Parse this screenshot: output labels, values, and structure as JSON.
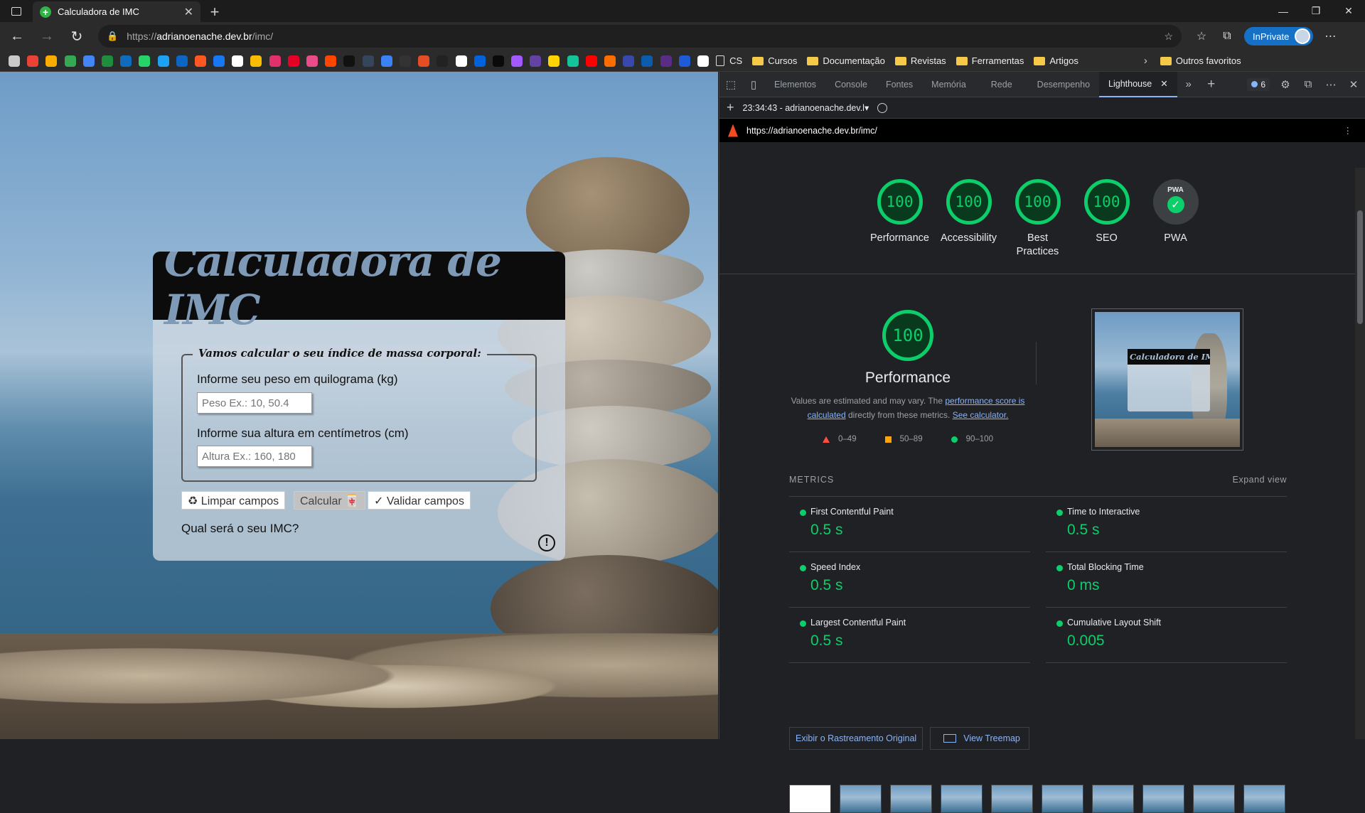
{
  "browser": {
    "tab_title": "Calculadora de IMC",
    "url_scheme": "https://",
    "url_host": "adrianoenache.dev.br",
    "url_path": "/imc/",
    "inprivate_label": "InPrivate"
  },
  "favorites": {
    "folders": [
      "CS",
      "Cursos",
      "Documentação",
      "Revistas",
      "Ferramentas",
      "Artigos"
    ],
    "other": "Outros favoritos",
    "icon_colors": [
      "#c9c9c9",
      "#ea4335",
      "#f9ab00",
      "#34a853",
      "#4285f4",
      "#1e8e3e",
      "#0f6cbd",
      "#25d366",
      "#1da1f2",
      "#0a66c2",
      "#ff5722",
      "#1877f2",
      "#ffffff",
      "#fbbc04",
      "#e1306c",
      "#e60023",
      "#ea4c89",
      "#ff4500",
      "#111111",
      "#35465c",
      "#3b82f6",
      "#333333",
      "#e44d26",
      "#222222",
      "#ffffff",
      "#0063dc",
      "#0a0a0a",
      "#a259ff",
      "#6441a5",
      "#ffd400",
      "#15c39a",
      "#ff0000",
      "#ff6d00",
      "#3949ab",
      "#0b5cad",
      "#5b2c83",
      "#1e5bd8",
      "#ffffff"
    ]
  },
  "page": {
    "title": "Calculadora de IMC",
    "legend": "Vamos calcular o seu índice de massa corporal:",
    "weight_label": "Informe seu peso em quilograma (kg)",
    "weight_placeholder": "Peso Ex.: 10, 50.4",
    "height_label": "Informe sua altura em centímetros (cm)",
    "height_placeholder": "Altura Ex.: 160, 180",
    "btn_clear": "♻ Limpar campos",
    "btn_calc": "Calcular 🀄",
    "btn_validate": "✓ Validar campos",
    "result": "Qual será o seu IMC?",
    "alert_icon": "!"
  },
  "devtools": {
    "tabs": [
      "Elementos",
      "Console",
      "Fontes",
      "Memória",
      "Rede",
      "Desempenho",
      "Lighthouse"
    ],
    "active_tab": "Lighthouse",
    "issues_count": "6",
    "report_select": "23:34:43 - adrianoenache.dev.l",
    "report_url": "https://adrianoenache.dev.br/imc/"
  },
  "lighthouse": {
    "scores": [
      {
        "label": "Performance",
        "value": "100"
      },
      {
        "label": "Accessibility",
        "value": "100"
      },
      {
        "label": "Best Practices",
        "value": "100"
      },
      {
        "label": "SEO",
        "value": "100"
      }
    ],
    "pwa_label": "PWA",
    "pwa_badge": "PWA",
    "perf_score": "100",
    "perf_title": "Performance",
    "desc_1": "Values are estimated and may vary. The ",
    "desc_link_1": "performance score is calculated",
    "desc_2": " directly from these metrics. ",
    "desc_link_2": "See calculator.",
    "legend": [
      "0–49",
      "50–89",
      "90–100"
    ],
    "screenshot_title": "Calculadora de IMC",
    "metrics_label": "METRICS",
    "expand_label": "Expand view",
    "metrics": [
      {
        "name": "First Contentful Paint",
        "value": "0.5 s"
      },
      {
        "name": "Time to Interactive",
        "value": "0.5 s"
      },
      {
        "name": "Speed Index",
        "value": "0.5 s"
      },
      {
        "name": "Total Blocking Time",
        "value": "0 ms"
      },
      {
        "name": "Largest Contentful Paint",
        "value": "0.5 s"
      },
      {
        "name": "Cumulative Layout Shift",
        "value": "0.005"
      }
    ],
    "btn_trace": "Exibir o Rastreamento Original",
    "btn_treemap": "View Treemap"
  },
  "colors": {
    "pass": "#0cce6b",
    "accent": "#8ab4f8",
    "inprivate": "#1670c6"
  }
}
